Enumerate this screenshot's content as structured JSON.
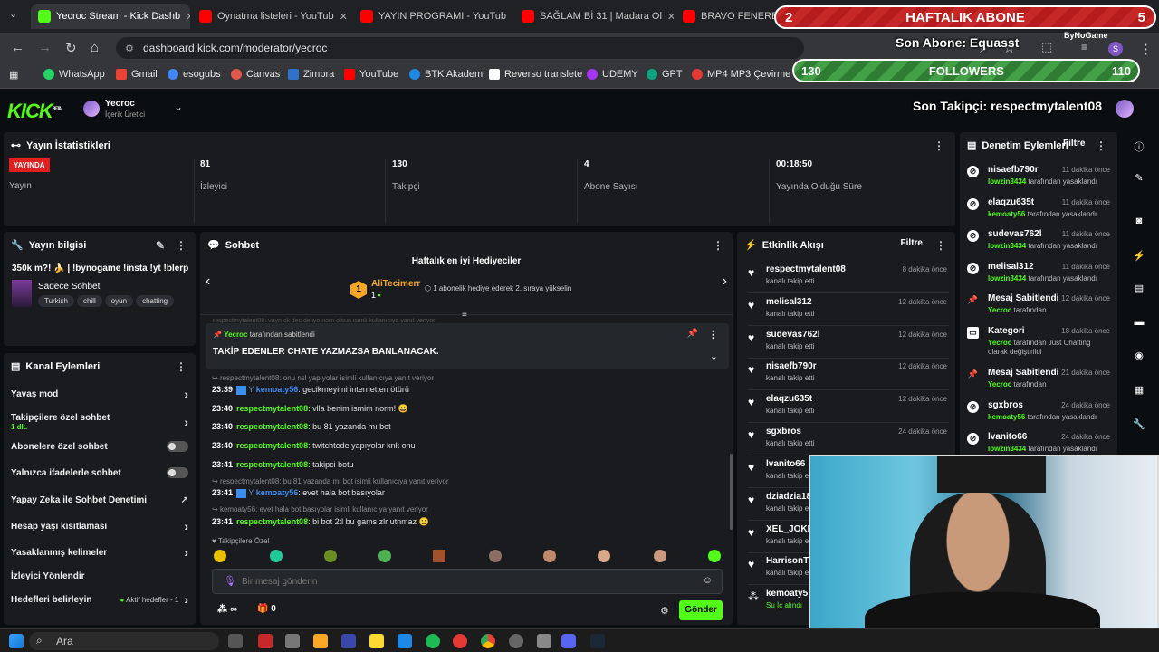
{
  "browser": {
    "tabs": [
      {
        "label": "Yecroc Stream - Kick Dashb",
        "active": true
      },
      {
        "label": "Oynatma listeleri - YouTub"
      },
      {
        "label": "YAYIN PROGRAMI - YouTub"
      },
      {
        "label": "SAĞLAM Bİ 31 | Madara Ol"
      },
      {
        "label": "BRAVO FENERBAH"
      }
    ],
    "url": "dashboard.kick.com/moderator/yecroc",
    "bookmarks": [
      "WhatsApp",
      "Gmail",
      "esogubs",
      "Canvas",
      "Zimbra",
      "YouTube",
      "BTK Akademi",
      "Reverso translete",
      "UDEMY",
      "GPT",
      "MP4 MP3 Çevirme"
    ]
  },
  "overlay": {
    "sub_goal_current": "2",
    "sub_goal_label": "HAFTALIK ABONE",
    "sub_goal_target": "5",
    "last_sub": "Son Abone: Equasst",
    "watermark": "ByNoGame",
    "followers_current": "130",
    "followers_label": "FOLLOWERS",
    "followers_target": "110",
    "last_follower": "Son Takipçi: respectmytalent08"
  },
  "header": {
    "logo": "KICK",
    "logo_beta": "BETA",
    "user_name": "Yecroc",
    "user_role": "İçerik Üretici"
  },
  "stats": {
    "title": "Yayın İstatistikleri",
    "items": [
      {
        "value": "YAYINDA",
        "label": "Yayın"
      },
      {
        "value": "81",
        "label": "İzleyici"
      },
      {
        "value": "130",
        "label": "Takipçi"
      },
      {
        "value": "4",
        "label": "Abone Sayısı"
      },
      {
        "value": "00:18:50",
        "label": "Yayında Olduğu Süre"
      }
    ]
  },
  "stream_info": {
    "title": "Yayın bilgisi",
    "stream_title": "350k m?! 🍌 | !bynogame !insta !yt !blerp",
    "category": "Sadece Sohbet",
    "tags": [
      "Turkish",
      "chill",
      "oyun",
      "chatting"
    ]
  },
  "channel_actions": {
    "title": "Kanal Eylemleri",
    "rows": [
      {
        "label": "Yavaş mod",
        "kind": "chevron"
      },
      {
        "label": "Takipçilere özel sohbet",
        "sub": "1 dk.",
        "kind": "chevron"
      },
      {
        "label": "Abonelere özel sohbet",
        "kind": "toggle"
      },
      {
        "label": "Yalnızca ifadelerle sohbet",
        "kind": "toggle"
      },
      {
        "label": "Yapay Zeka ile Sohbet Denetimi",
        "kind": "link"
      },
      {
        "label": "Hesap yaşı kısıtlaması",
        "kind": "chevron"
      },
      {
        "label": "Yasaklanmış kelimeler",
        "kind": "chevron"
      },
      {
        "label": "İzleyici Yönlendir",
        "kind": "none"
      },
      {
        "label": "Hedefleri belirleyin",
        "extra": "Aktif hedefler - 1",
        "kind": "chevron"
      }
    ]
  },
  "chat": {
    "title": "Sohbet",
    "gifters_title": "Haftalık en iyi Hediyeciler",
    "gifter_name": "AliTecimerr",
    "gifter_count": "1",
    "gifter_rank": "1",
    "gifter_msg": "1 abonelik hediye ederek 2. sıraya yükselin",
    "top_faded": "respectmytalent08: vayn ck dec deliyo norn olsun isimli kullanıcıya yanıt veriyor",
    "pinned_by": "Yecroc",
    "pinned_by_suffix": "tarafından sabitlendi",
    "pinned_text": "TAKİP EDENLER CHATE YAZMAZSA BANLANACAK.",
    "messages": [
      {
        "reply": "respectmytalent08: onu nsl yapıyolar isimli kullanıcıya yanıt veriyor",
        "time": "23:39",
        "user": "kemoaty56",
        "color": "blue",
        "text": ": gecikmeyimi internetten ötürü"
      },
      {
        "time": "23:40",
        "user": "respectmytalent08",
        "color": "green",
        "text": ": vlla benim ismim norm! 😀"
      },
      {
        "time": "23:40",
        "user": "respectmytalent08",
        "color": "green",
        "text": ": bu 81 yazanda mı bot"
      },
      {
        "time": "23:40",
        "user": "respectmytalent08",
        "color": "green",
        "text": ": twitchtede yapıyolar knk onu"
      },
      {
        "time": "23:41",
        "user": "respectmytalent08",
        "color": "green",
        "text": ": takipci botu"
      },
      {
        "reply": "respectmytalent08: bu 81 yazanda mı bot isimli kullanıcıya yanıt veriyor",
        "time": "23:41",
        "user": "kemoaty56",
        "color": "blue",
        "text": ": evet hala bot basıyolar"
      },
      {
        "reply": "kemoaty56: evet hala bot basıyolar isimli kullanıcıya yanıt veriyor",
        "time": "23:41",
        "user": "respectmytalent08",
        "color": "green",
        "text": ": bi bot 2tl bu gamsızlr utnmaz 😀"
      }
    ],
    "emote_label": "Takipçilere Özel",
    "input_placeholder": "Bir mesaj gönderin",
    "points_label": "∞",
    "gift_count": "0",
    "send_label": "Gönder"
  },
  "activity": {
    "title": "Etkinlik Akışı",
    "filter": "Filtre",
    "items": [
      {
        "name": "respectmytalent08",
        "sub": "kanalı takip etti",
        "time": "8 dakika önce"
      },
      {
        "name": "melisal312",
        "sub": "kanalı takip etti",
        "time": "12 dakika önce"
      },
      {
        "name": "sudevas762l",
        "sub": "kanalı takip etti",
        "time": "12 dakika önce"
      },
      {
        "name": "nisaefb790r",
        "sub": "kanalı takip etti",
        "time": "12 dakika önce"
      },
      {
        "name": "elaqzu635t",
        "sub": "kanalı takip etti",
        "time": "12 dakika önce"
      },
      {
        "name": "sgxbros",
        "sub": "kanalı takip etti",
        "time": "24 dakika önce"
      },
      {
        "name": "lvanito66",
        "sub": "kanalı takip etti",
        "time": ""
      },
      {
        "name": "dziadzia18",
        "sub": "kanalı takip etti",
        "time": ""
      },
      {
        "name": "XEL_JOKE",
        "sub": "kanalı takip etti",
        "time": ""
      },
      {
        "name": "HarrisonT",
        "sub": "kanalı takip etti",
        "time": ""
      },
      {
        "name": "kemoaty5",
        "sub": "Su İç alındı",
        "time": ""
      }
    ]
  },
  "moderation": {
    "title": "Denetim Eylemleri",
    "filter": "Filtre",
    "items": [
      {
        "name": "nisaefb790r",
        "time": "11 dakika önce",
        "by": "lowzin3434",
        "suffix": "tarafından yasaklandı"
      },
      {
        "name": "elaqzu635t",
        "time": "11 dakika önce",
        "by": "kemoaty56",
        "suffix": "tarafından yasaklandı"
      },
      {
        "name": "sudevas762l",
        "time": "11 dakika önce",
        "by": "lowzin3434",
        "suffix": "tarafından yasaklandı"
      },
      {
        "name": "melisal312",
        "time": "11 dakika önce",
        "by": "lowzin3434",
        "suffix": "tarafından yasaklandı"
      },
      {
        "name": "Mesaj Sabitlendi",
        "time": "12 dakika önce",
        "by": "Yecroc",
        "suffix": "tarafından"
      },
      {
        "name": "Kategori",
        "time": "18 dakika önce",
        "by": "Yecroc",
        "suffix": "tarafından Just Chatting olarak değiştirildi"
      },
      {
        "name": "Mesaj Sabitlendi",
        "time": "21 dakika önce",
        "by": "Yecroc",
        "suffix": "tarafından"
      },
      {
        "name": "sgxbros",
        "time": "24 dakika önce",
        "by": "kemoaty56",
        "suffix": "tarafından yasaklandı"
      },
      {
        "name": "lvanito66",
        "time": "24 dakika önce",
        "by": "lowzin3434",
        "suffix": "tarafından yasaklandı"
      }
    ]
  },
  "taskbar": {
    "search_placeholder": "Ara"
  }
}
